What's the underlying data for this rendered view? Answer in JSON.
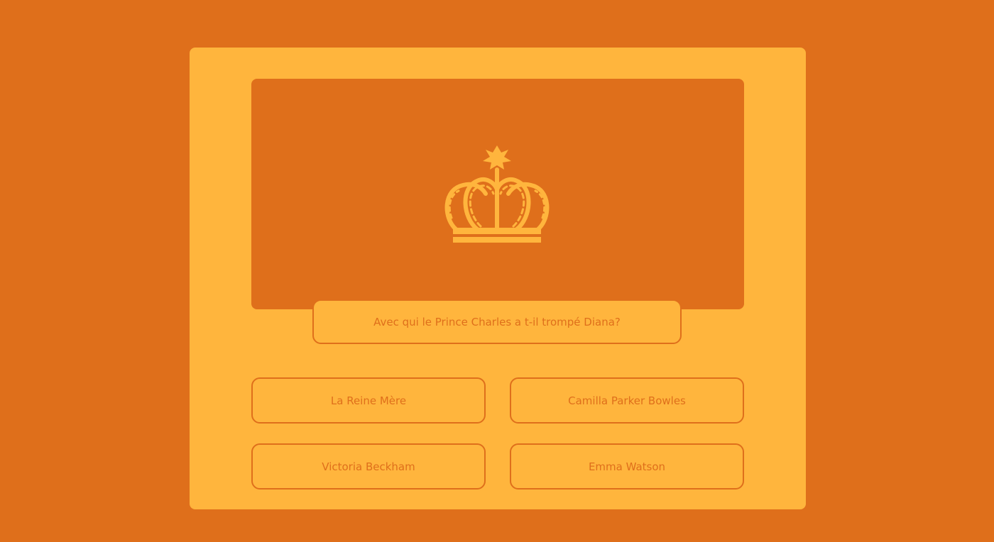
{
  "quiz": {
    "question": "Avec qui le Prince Charles a t-il trompé Diana?",
    "image_icon": "crown-icon",
    "answers": [
      "La Reine Mère",
      "Camilla Parker Bowles",
      "Victoria Beckham",
      "Emma Watson"
    ]
  },
  "colors": {
    "background": "#df6f1b",
    "card": "#ffb53d",
    "accent": "#df6f1b"
  }
}
